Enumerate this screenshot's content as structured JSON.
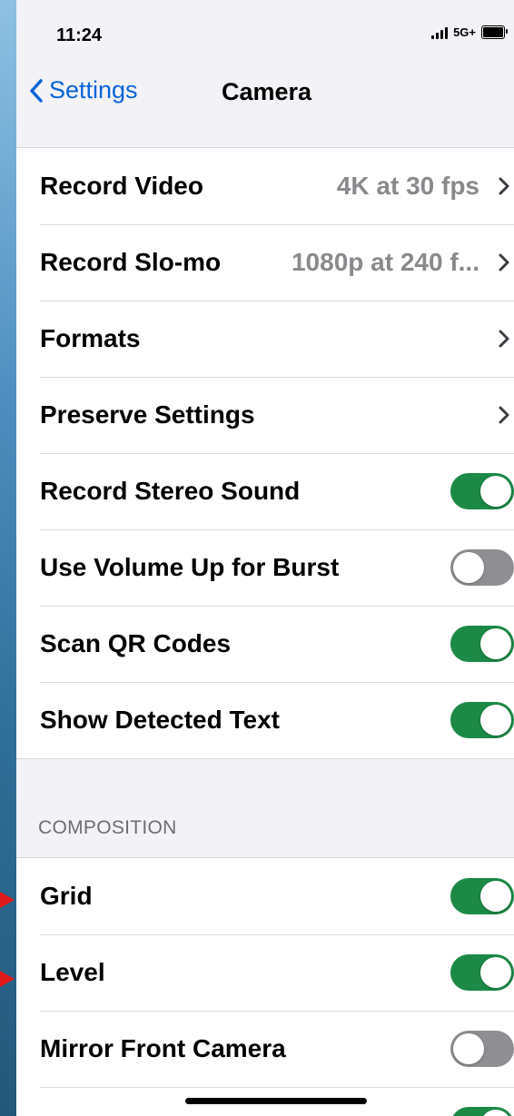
{
  "status_bar": {
    "time": "11:24",
    "network": "5G+"
  },
  "nav": {
    "back_label": "Settings",
    "title": "Camera"
  },
  "settings_group": [
    {
      "label": "Record Video",
      "value": "4K at 30 fps",
      "type": "link"
    },
    {
      "label": "Record Slo-mo",
      "value": "1080p at 240 f...",
      "type": "link"
    },
    {
      "label": "Formats",
      "value": "",
      "type": "link"
    },
    {
      "label": "Preserve Settings",
      "value": "",
      "type": "link"
    },
    {
      "label": "Record Stereo Sound",
      "type": "toggle",
      "on": true
    },
    {
      "label": "Use Volume Up for Burst",
      "type": "toggle",
      "on": false
    },
    {
      "label": "Scan QR Codes",
      "type": "toggle",
      "on": true
    },
    {
      "label": "Show Detected Text",
      "type": "toggle",
      "on": true
    }
  ],
  "composition": {
    "header": "COMPOSITION",
    "items": [
      {
        "label": "Grid",
        "type": "toggle",
        "on": true
      },
      {
        "label": "Level",
        "type": "toggle",
        "on": true
      },
      {
        "label": "Mirror Front Camera",
        "type": "toggle",
        "on": false
      },
      {
        "label": "",
        "type": "toggle",
        "on": true
      }
    ]
  },
  "colors": {
    "accent": "#0a64d8",
    "toggle_on": "#1c8a46",
    "toggle_off": "#8e8e93",
    "annotation_arrow": "#e01a1a"
  }
}
